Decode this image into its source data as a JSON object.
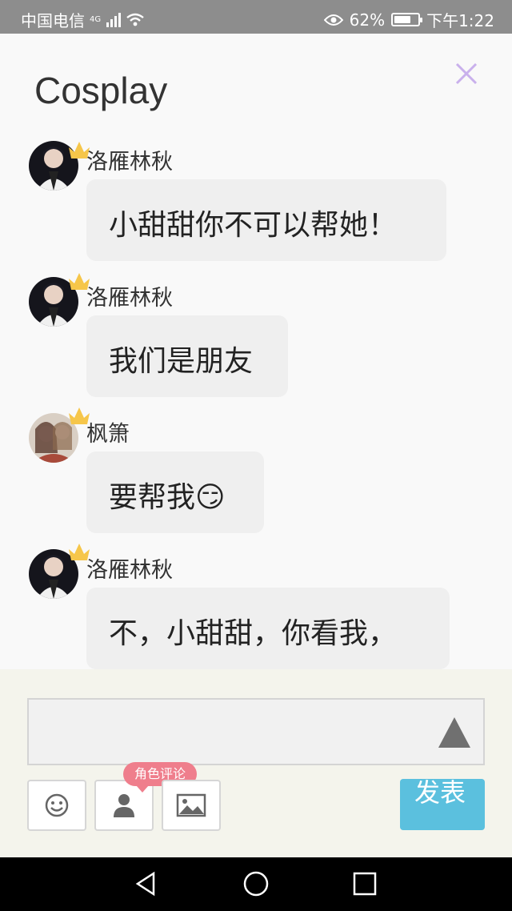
{
  "status_bar": {
    "carrier": "中国电信",
    "network": "4G",
    "battery": "62%",
    "time": "下午1:22"
  },
  "header": {
    "title": "Cosplay",
    "close_icon": "close-icon"
  },
  "messages": [
    {
      "name": "洛雁林秋",
      "text": "小甜甜你不可以帮她！"
    },
    {
      "name": "洛雁林秋",
      "text": "我们是朋友"
    },
    {
      "name": "枫箫",
      "text": "要帮我😏"
    },
    {
      "name": "洛雁林秋",
      "text": "不，小甜甜，你看我，"
    }
  ],
  "composer": {
    "input_value": "",
    "role_comment_badge": "角色评论",
    "send_label": "发表"
  },
  "colors": {
    "accent": "#5bc0de",
    "badge": "#ef7e8c",
    "close": "#c9b0ec",
    "crown": "#f6c64a"
  }
}
